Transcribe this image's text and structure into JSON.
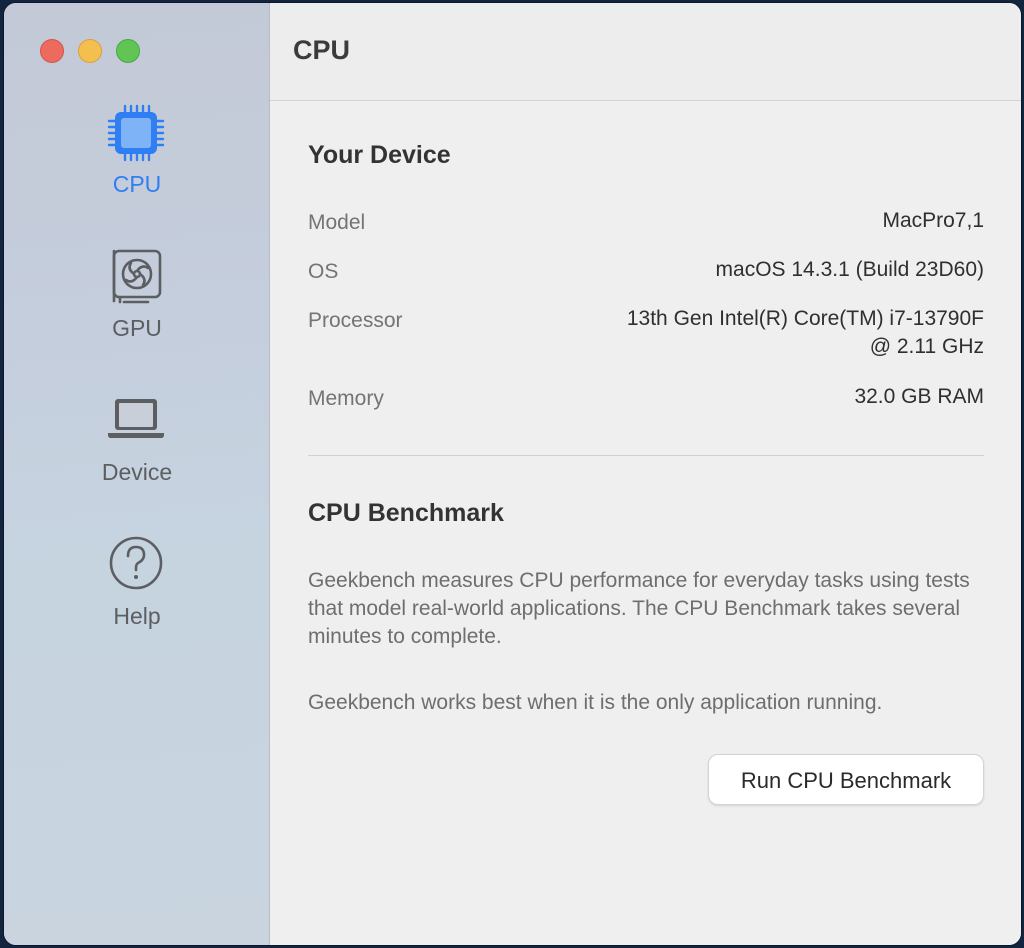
{
  "window": {
    "title": "CPU"
  },
  "sidebar": {
    "items": [
      {
        "label": "CPU",
        "icon": "cpu-chip-icon",
        "active": true
      },
      {
        "label": "GPU",
        "icon": "gpu-card-icon",
        "active": false
      },
      {
        "label": "Device",
        "icon": "laptop-icon",
        "active": false
      },
      {
        "label": "Help",
        "icon": "question-circle-icon",
        "active": false
      }
    ]
  },
  "device": {
    "heading": "Your Device",
    "rows": [
      {
        "label": "Model",
        "value": "MacPro7,1"
      },
      {
        "label": "OS",
        "value": "macOS 14.3.1 (Build 23D60)"
      },
      {
        "label": "Processor",
        "value_line1": "13th Gen Intel(R) Core(TM) i7-13790F",
        "value_line2": "@ 2.11 GHz"
      },
      {
        "label": "Memory",
        "value": "32.0 GB RAM"
      }
    ]
  },
  "benchmark": {
    "heading": "CPU Benchmark",
    "description": "Geekbench measures CPU performance for everyday tasks using tests that model real-world applications. The CPU Benchmark takes several minutes to complete.",
    "note": "Geekbench works best when it is the only application running.",
    "button_label": "Run CPU Benchmark"
  },
  "colors": {
    "accent": "#2f7ff2",
    "close": "#ed6a5e",
    "minimize": "#f5bf4f",
    "zoom": "#61c554"
  }
}
